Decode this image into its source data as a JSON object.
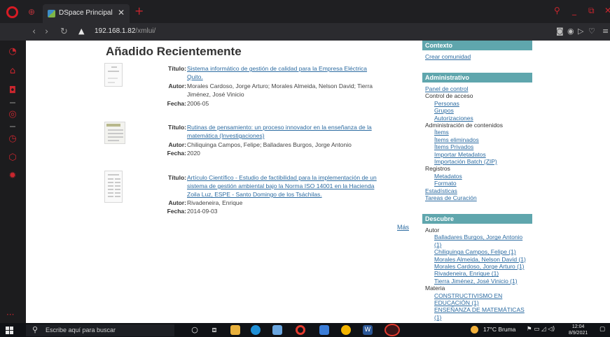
{
  "browser": {
    "tab_title": "DSpace Principal",
    "tab_close": "✕",
    "new_tab": "+",
    "url_host": "192.168.1.82",
    "url_path": "/xmlui/"
  },
  "page": {
    "heading": "Añadido Recientemente",
    "items": [
      {
        "title_label": "Título:",
        "title_lines": [
          "Sistema informático de gestión de calidad para la Empresa Eléctrica",
          "Quito."
        ],
        "author_label": "Autor:",
        "author_lines": [
          "Morales Cardoso, Jorge Arturo; Morales Almeida, Nelson David; Tierra",
          "Jiménez, José Vinicio"
        ],
        "date_label": "Fecha:",
        "date": "2006-05"
      },
      {
        "title_label": "Título:",
        "title_lines": [
          "Rutinas de pensamiento: un proceso innovador en la enseñanza de la",
          "matemática (Investigaciones)"
        ],
        "author_label": "Autor:",
        "author_lines": [
          "Chiliquinga Campos, Felipe; Balladares Burgos, Jorge Antonio"
        ],
        "date_label": "Fecha:",
        "date": "2020"
      },
      {
        "title_label": "Título:",
        "title_lines": [
          "Artículo Científico - Estudio de factibilidad para la implementación de un",
          "sistema de gestión ambiental bajo la Norma ISO 14001 en la Hacienda",
          "Zoila Luz, ESPE - Santo Domingo de los Tsáchilas."
        ],
        "author_label": "Autor:",
        "author_lines": [
          "Rivadeneira, Enrique"
        ],
        "date_label": "Fecha:",
        "date": "2014-09-03"
      }
    ],
    "more": "Más"
  },
  "sidebar": {
    "contexto": {
      "heading": "Contexto",
      "create_community": "Crear comunidad"
    },
    "admin": {
      "heading": "Administrativo",
      "control_panel": "Panel de control",
      "access_control": "Control de acceso",
      "people": "Personas",
      "groups": "Grupos",
      "authorizations": "Autorizaciones",
      "content_admin": "Administración de contenidos",
      "items": "Ítems",
      "withdrawn_items": "Ítems eliminados",
      "private_items": "Ítems Privados",
      "import_metadata": "Importar Metadatos",
      "batch_import": "Importación Batch (ZIP)",
      "registries": "Registros",
      "metadata": "Metadatos",
      "format": "Formato",
      "statistics": "Estadísticas",
      "curation_tasks": "Tareas de Curación"
    },
    "discover": {
      "heading": "Descubre",
      "author_label": "Autor",
      "authors": [
        "Balladares Burgos, Jorge Antonio",
        "(1)",
        "Chiliquinga Campos, Felipe (1)",
        "Morales Almeida, Nelson David (1)",
        "Morales Cardoso, Jorge Arturo (1)",
        "Rivadeneira, Enrique (1)",
        "Tierra Jiménez, José Vinicio (1)"
      ],
      "subject_label": "Materia",
      "subjects": [
        "CONSTRUCTIVISMO EN",
        "EDUCACIÓN (1)",
        "ENSEÑANZA DE MATEMÁTICAS",
        "(1)"
      ]
    }
  },
  "taskbar": {
    "search_placeholder": "Escribe aquí para buscar",
    "weather": "17°C  Bruma",
    "time": "12:04",
    "date": "8/9/2021"
  },
  "colors": {
    "panel_header": "#5fa6ad",
    "link": "#2d6ca2",
    "opera_red": "#c9262e"
  }
}
